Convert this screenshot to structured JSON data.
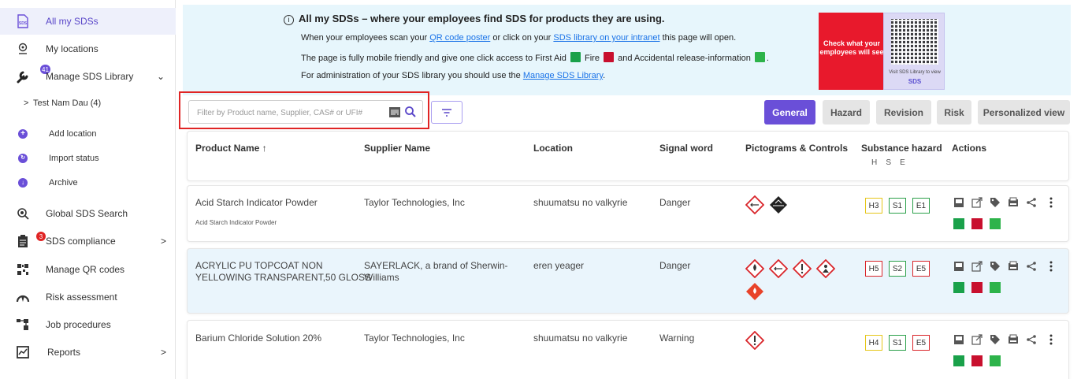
{
  "sidebar": {
    "items": [
      {
        "label": "All my SDSs",
        "icon": "sds-icon",
        "active": true
      },
      {
        "label": "My locations",
        "icon": "location-pin-icon"
      },
      {
        "label": "Manage SDS Library",
        "icon": "wrench-icon",
        "badge": "41",
        "arrow": "⌄"
      },
      {
        "label": "Test Nam Dau (4)",
        "icon": "chevron-right-icon",
        "prefix": ">"
      },
      {
        "label": "Add location",
        "icon": "plus-circle-icon"
      },
      {
        "label": "Import status",
        "icon": "import-status-icon"
      },
      {
        "label": "Archive",
        "icon": "archive-icon"
      },
      {
        "label": "Global SDS Search",
        "icon": "global-search-icon"
      },
      {
        "label": "SDS compliance",
        "icon": "compliance-icon",
        "badge": "3",
        "arrow": ">"
      },
      {
        "label": "Manage QR codes",
        "icon": "qr-code-icon"
      },
      {
        "label": "Risk assessment",
        "icon": "gauge-icon"
      },
      {
        "label": "Job procedures",
        "icon": "job-procedures-icon"
      },
      {
        "label": "Reports",
        "icon": "reports-icon",
        "arrow": ">"
      }
    ]
  },
  "banner": {
    "title": "All my SDSs – where your employees find SDS for products they are using.",
    "line1_pre": "When your employees scan your ",
    "line1_link1": "QR code poster",
    "line1_mid": " or click on your ",
    "line1_link2": "SDS library on your intranet",
    "line1_post": " this page will open.",
    "line2_pre": "The page is fully mobile friendly and give one click access to First Aid",
    "line2_fire": "Fire",
    "line2_post": "and Accidental release-information",
    "line3_pre": "For administration of your SDS library you should use the ",
    "line3_link": "Manage SDS Library",
    "line3_post": ".",
    "promo_text": "Check what your employees will see",
    "qr_caption": "Visit SDS Library to view",
    "qr_logo": "SDS"
  },
  "search": {
    "placeholder": "Filter by Product name, Supplier, CAS# or UFI#"
  },
  "tabs": [
    {
      "label": "General",
      "active": true
    },
    {
      "label": "Hazard"
    },
    {
      "label": "Revision"
    },
    {
      "label": "Risk"
    },
    {
      "label": "Personalized view"
    }
  ],
  "table": {
    "headers": {
      "product": "Product Name ↑",
      "supplier": "Supplier Name",
      "location": "Location",
      "signal": "Signal word",
      "pictograms": "Pictograms & Controls",
      "substance": "Substance hazard",
      "substance_sub": "H    S    E",
      "actions": "Actions"
    },
    "rows": [
      {
        "product": "Acid Starch Indicator Powder",
        "product_sub": "Acid Starch Indicator Powder",
        "supplier": "Taylor Technologies, Inc",
        "location": "shuumatsu no valkyrie",
        "signal": "Danger",
        "h": "H3",
        "s": "S1",
        "e": "E1",
        "h_color": "y"
      },
      {
        "product_l1": "ACRYLIC PU TOPCOAT NON",
        "product_l2": "YELLOWING TRANSPARENT,50 GLOSS",
        "supplier_l1": "SAYERLACK, a brand of Sherwin-",
        "supplier_l2": "Williams",
        "location": "eren yeager",
        "signal": "Danger",
        "h": "H5",
        "s": "S2",
        "e": "E5",
        "h_color": "r"
      },
      {
        "product": "Barium Chloride Solution 20%",
        "supplier": "Taylor Technologies, Inc",
        "location": "shuumatsu no valkyrie",
        "signal": "Warning",
        "h": "H4",
        "s": "S1",
        "e": "E5",
        "h_color": "y"
      }
    ]
  }
}
